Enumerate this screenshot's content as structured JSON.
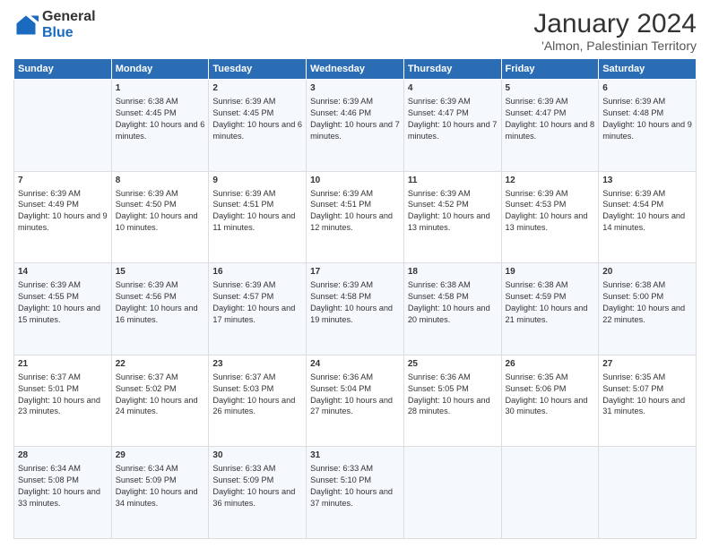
{
  "logo": {
    "general": "General",
    "blue": "Blue"
  },
  "title": "January 2024",
  "subtitle": "'Almon, Palestinian Territory",
  "days": [
    "Sunday",
    "Monday",
    "Tuesday",
    "Wednesday",
    "Thursday",
    "Friday",
    "Saturday"
  ],
  "weeks": [
    [
      {
        "day": "",
        "sunrise": "",
        "sunset": "",
        "daylight": ""
      },
      {
        "day": "1",
        "sunrise": "Sunrise: 6:38 AM",
        "sunset": "Sunset: 4:45 PM",
        "daylight": "Daylight: 10 hours and 6 minutes."
      },
      {
        "day": "2",
        "sunrise": "Sunrise: 6:39 AM",
        "sunset": "Sunset: 4:45 PM",
        "daylight": "Daylight: 10 hours and 6 minutes."
      },
      {
        "day": "3",
        "sunrise": "Sunrise: 6:39 AM",
        "sunset": "Sunset: 4:46 PM",
        "daylight": "Daylight: 10 hours and 7 minutes."
      },
      {
        "day": "4",
        "sunrise": "Sunrise: 6:39 AM",
        "sunset": "Sunset: 4:47 PM",
        "daylight": "Daylight: 10 hours and 7 minutes."
      },
      {
        "day": "5",
        "sunrise": "Sunrise: 6:39 AM",
        "sunset": "Sunset: 4:47 PM",
        "daylight": "Daylight: 10 hours and 8 minutes."
      },
      {
        "day": "6",
        "sunrise": "Sunrise: 6:39 AM",
        "sunset": "Sunset: 4:48 PM",
        "daylight": "Daylight: 10 hours and 9 minutes."
      }
    ],
    [
      {
        "day": "7",
        "sunrise": "Sunrise: 6:39 AM",
        "sunset": "Sunset: 4:49 PM",
        "daylight": "Daylight: 10 hours and 9 minutes."
      },
      {
        "day": "8",
        "sunrise": "Sunrise: 6:39 AM",
        "sunset": "Sunset: 4:50 PM",
        "daylight": "Daylight: 10 hours and 10 minutes."
      },
      {
        "day": "9",
        "sunrise": "Sunrise: 6:39 AM",
        "sunset": "Sunset: 4:51 PM",
        "daylight": "Daylight: 10 hours and 11 minutes."
      },
      {
        "day": "10",
        "sunrise": "Sunrise: 6:39 AM",
        "sunset": "Sunset: 4:51 PM",
        "daylight": "Daylight: 10 hours and 12 minutes."
      },
      {
        "day": "11",
        "sunrise": "Sunrise: 6:39 AM",
        "sunset": "Sunset: 4:52 PM",
        "daylight": "Daylight: 10 hours and 13 minutes."
      },
      {
        "day": "12",
        "sunrise": "Sunrise: 6:39 AM",
        "sunset": "Sunset: 4:53 PM",
        "daylight": "Daylight: 10 hours and 13 minutes."
      },
      {
        "day": "13",
        "sunrise": "Sunrise: 6:39 AM",
        "sunset": "Sunset: 4:54 PM",
        "daylight": "Daylight: 10 hours and 14 minutes."
      }
    ],
    [
      {
        "day": "14",
        "sunrise": "Sunrise: 6:39 AM",
        "sunset": "Sunset: 4:55 PM",
        "daylight": "Daylight: 10 hours and 15 minutes."
      },
      {
        "day": "15",
        "sunrise": "Sunrise: 6:39 AM",
        "sunset": "Sunset: 4:56 PM",
        "daylight": "Daylight: 10 hours and 16 minutes."
      },
      {
        "day": "16",
        "sunrise": "Sunrise: 6:39 AM",
        "sunset": "Sunset: 4:57 PM",
        "daylight": "Daylight: 10 hours and 17 minutes."
      },
      {
        "day": "17",
        "sunrise": "Sunrise: 6:39 AM",
        "sunset": "Sunset: 4:58 PM",
        "daylight": "Daylight: 10 hours and 19 minutes."
      },
      {
        "day": "18",
        "sunrise": "Sunrise: 6:38 AM",
        "sunset": "Sunset: 4:58 PM",
        "daylight": "Daylight: 10 hours and 20 minutes."
      },
      {
        "day": "19",
        "sunrise": "Sunrise: 6:38 AM",
        "sunset": "Sunset: 4:59 PM",
        "daylight": "Daylight: 10 hours and 21 minutes."
      },
      {
        "day": "20",
        "sunrise": "Sunrise: 6:38 AM",
        "sunset": "Sunset: 5:00 PM",
        "daylight": "Daylight: 10 hours and 22 minutes."
      }
    ],
    [
      {
        "day": "21",
        "sunrise": "Sunrise: 6:37 AM",
        "sunset": "Sunset: 5:01 PM",
        "daylight": "Daylight: 10 hours and 23 minutes."
      },
      {
        "day": "22",
        "sunrise": "Sunrise: 6:37 AM",
        "sunset": "Sunset: 5:02 PM",
        "daylight": "Daylight: 10 hours and 24 minutes."
      },
      {
        "day": "23",
        "sunrise": "Sunrise: 6:37 AM",
        "sunset": "Sunset: 5:03 PM",
        "daylight": "Daylight: 10 hours and 26 minutes."
      },
      {
        "day": "24",
        "sunrise": "Sunrise: 6:36 AM",
        "sunset": "Sunset: 5:04 PM",
        "daylight": "Daylight: 10 hours and 27 minutes."
      },
      {
        "day": "25",
        "sunrise": "Sunrise: 6:36 AM",
        "sunset": "Sunset: 5:05 PM",
        "daylight": "Daylight: 10 hours and 28 minutes."
      },
      {
        "day": "26",
        "sunrise": "Sunrise: 6:35 AM",
        "sunset": "Sunset: 5:06 PM",
        "daylight": "Daylight: 10 hours and 30 minutes."
      },
      {
        "day": "27",
        "sunrise": "Sunrise: 6:35 AM",
        "sunset": "Sunset: 5:07 PM",
        "daylight": "Daylight: 10 hours and 31 minutes."
      }
    ],
    [
      {
        "day": "28",
        "sunrise": "Sunrise: 6:34 AM",
        "sunset": "Sunset: 5:08 PM",
        "daylight": "Daylight: 10 hours and 33 minutes."
      },
      {
        "day": "29",
        "sunrise": "Sunrise: 6:34 AM",
        "sunset": "Sunset: 5:09 PM",
        "daylight": "Daylight: 10 hours and 34 minutes."
      },
      {
        "day": "30",
        "sunrise": "Sunrise: 6:33 AM",
        "sunset": "Sunset: 5:09 PM",
        "daylight": "Daylight: 10 hours and 36 minutes."
      },
      {
        "day": "31",
        "sunrise": "Sunrise: 6:33 AM",
        "sunset": "Sunset: 5:10 PM",
        "daylight": "Daylight: 10 hours and 37 minutes."
      },
      {
        "day": "",
        "sunrise": "",
        "sunset": "",
        "daylight": ""
      },
      {
        "day": "",
        "sunrise": "",
        "sunset": "",
        "daylight": ""
      },
      {
        "day": "",
        "sunrise": "",
        "sunset": "",
        "daylight": ""
      }
    ]
  ]
}
